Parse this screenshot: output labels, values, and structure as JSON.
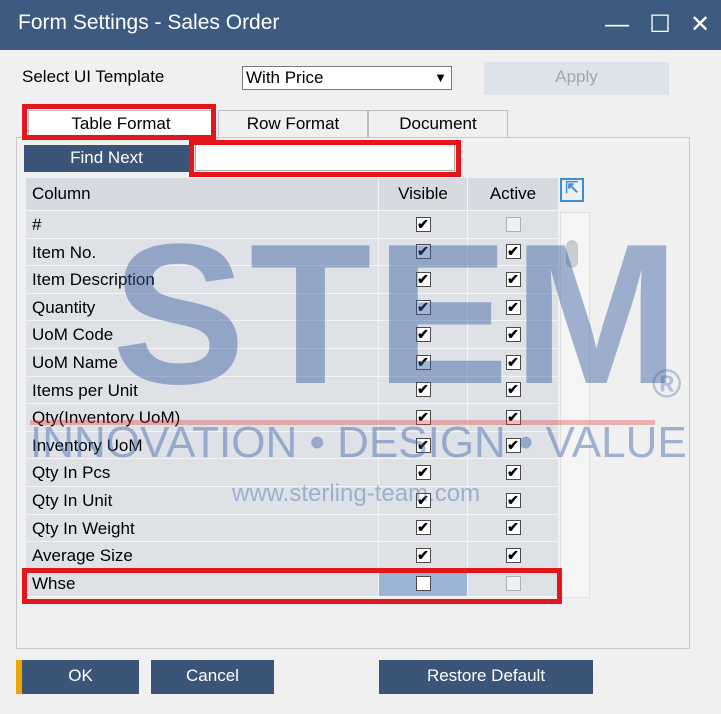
{
  "window": {
    "title": "Form Settings - Sales Order",
    "minimize_glyph": "—",
    "maximize_glyph": "☐",
    "close_glyph": "✕"
  },
  "template": {
    "label": "Select UI Template",
    "selected": "With Price",
    "apply_label": "Apply"
  },
  "tabs": [
    {
      "label": "Table Format",
      "active": true
    },
    {
      "label": "Row Format",
      "active": false
    },
    {
      "label": "Document",
      "active": false
    }
  ],
  "find": {
    "button_label": "Find Next",
    "input_value": ""
  },
  "grid": {
    "headers": [
      "Column",
      "Visible",
      "Active"
    ],
    "rows": [
      {
        "column": "#",
        "visible": true,
        "active": false,
        "active_enabled": false
      },
      {
        "column": "Item No.",
        "visible": true,
        "active": true,
        "active_enabled": true
      },
      {
        "column": "Item Description",
        "visible": true,
        "active": true,
        "active_enabled": true
      },
      {
        "column": "Quantity",
        "visible": true,
        "active": true,
        "active_enabled": true
      },
      {
        "column": "UoM Code",
        "visible": true,
        "active": true,
        "active_enabled": true
      },
      {
        "column": "UoM Name",
        "visible": true,
        "active": true,
        "active_enabled": true
      },
      {
        "column": "Items per Unit",
        "visible": true,
        "active": true,
        "active_enabled": true
      },
      {
        "column": "Qty(Inventory UoM)",
        "visible": true,
        "active": true,
        "active_enabled": true
      },
      {
        "column": "Inventory UoM",
        "visible": true,
        "active": true,
        "active_enabled": true
      },
      {
        "column": "Qty In Pcs",
        "visible": true,
        "active": true,
        "active_enabled": true
      },
      {
        "column": "Qty In Unit",
        "visible": true,
        "active": true,
        "active_enabled": true
      },
      {
        "column": "Qty In Weight",
        "visible": true,
        "active": true,
        "active_enabled": true
      },
      {
        "column": "Average Size",
        "visible": true,
        "active": true,
        "active_enabled": true
      },
      {
        "column": "Whse",
        "visible": false,
        "active": false,
        "active_enabled": false,
        "selected": true
      }
    ]
  },
  "watermark": {
    "brand": "STEM",
    "registered": "®",
    "tagline": "INNOVATION • DESIGN • VALUE",
    "url": "www.sterling-team.com"
  },
  "buttons": {
    "ok": "OK",
    "cancel": "Cancel",
    "restore": "Restore Default"
  },
  "icons": {
    "check": "✔",
    "dropdown": "▼",
    "expand": "⇱"
  },
  "colors": {
    "titlebar": "#3d5a80",
    "button": "#3a5578",
    "highlight": "#e3161c",
    "ok_accent": "#f0a500"
  }
}
